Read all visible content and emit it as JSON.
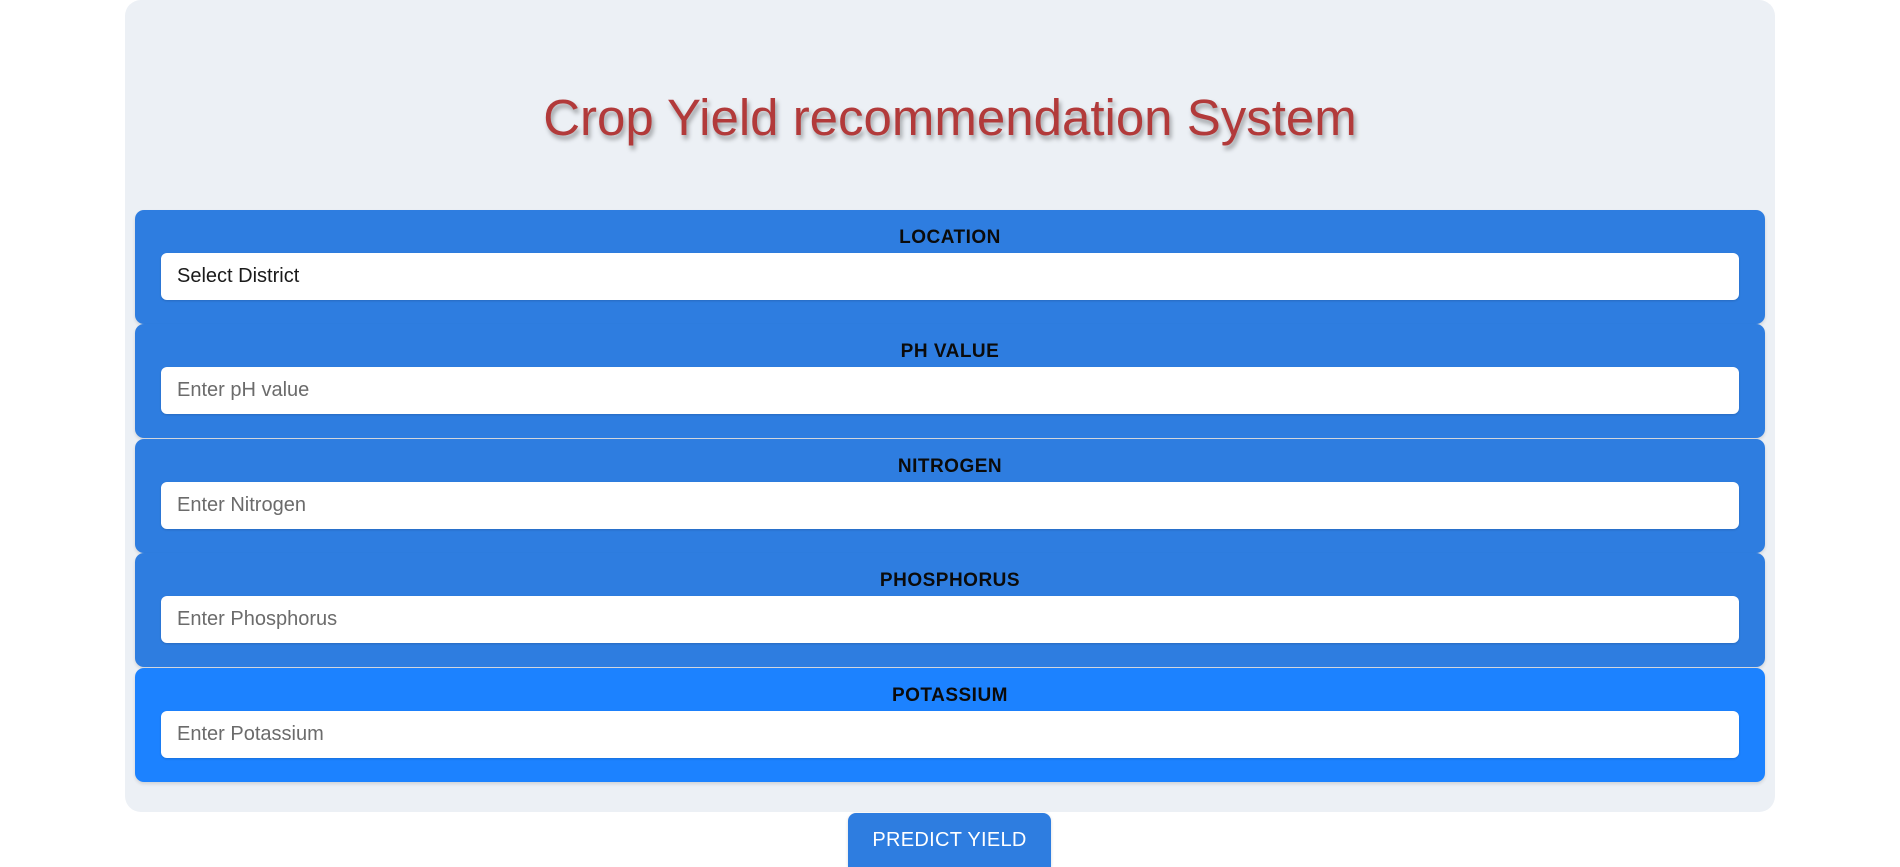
{
  "header": {
    "title": "Crop Yield recommendation System"
  },
  "form": {
    "location": {
      "label": "LOCATION",
      "value": "Select District"
    },
    "ph": {
      "label": "PH VALUE",
      "placeholder": "Enter pH value"
    },
    "nitrogen": {
      "label": "NITROGEN",
      "placeholder": "Enter Nitrogen"
    },
    "phosphorus": {
      "label": "PHOSPHORUS",
      "placeholder": "Enter Phosphorus"
    },
    "potassium": {
      "label": "POTASSIUM",
      "placeholder": "Enter Potassium"
    }
  },
  "actions": {
    "predict_label": "PREDICT YIELD"
  },
  "colors": {
    "title": "#b23a3a",
    "card": "#2e7de0",
    "card_active": "#1c82ff",
    "panel": "#ecf0f5",
    "button": "#2e7de0"
  }
}
